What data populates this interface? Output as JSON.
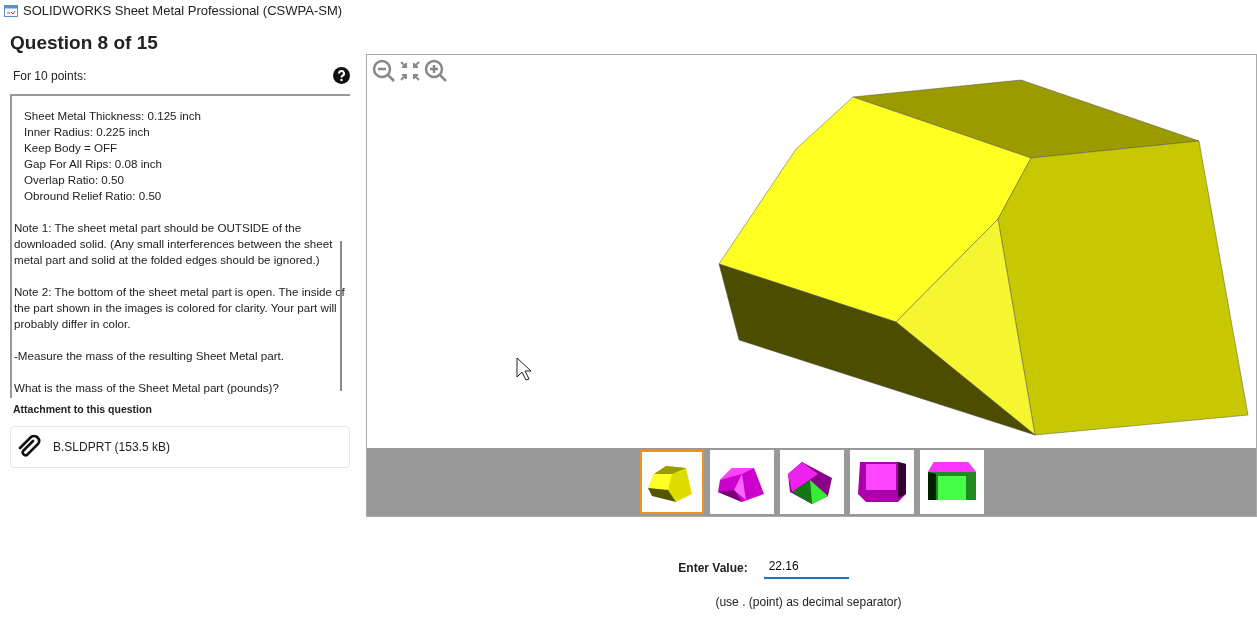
{
  "window": {
    "title": "SOLIDWORKS Sheet Metal Professional (CSWPA-SM)"
  },
  "question": {
    "title": "Question 8 of 15",
    "points": "For 10 points:",
    "parameters": [
      "Sheet Metal Thickness: 0.125 inch",
      "Inner Radius: 0.225 inch",
      "Keep Body = OFF",
      "Gap For All Rips: 0.08 inch",
      "Overlap Ratio: 0.50",
      "Obround Relief Ratio: 0.50"
    ],
    "paragraphs": [
      "Note 1: The sheet metal part should be OUTSIDE of the downloaded solid.  (Any small interferences between the sheet metal part and solid at the folded edges should be ignored.)",
      "Note 2: The bottom of the sheet metal part is open.  The inside of the part shown in the images is colored for clarity.  Your part will probably differ in color.",
      "-Measure the mass of the resulting Sheet Metal part.",
      "What is the mass of the Sheet Metal part (pounds)?"
    ]
  },
  "attachment": {
    "heading": "Attachment to this question",
    "file": "B.SLDPRT (153.5 kB)"
  },
  "viewer": {
    "thumbnails": [
      {
        "selected": true
      },
      {
        "selected": false
      },
      {
        "selected": false
      },
      {
        "selected": false
      },
      {
        "selected": false
      }
    ]
  },
  "answer": {
    "label": "Enter Value:",
    "value": "22.16",
    "hint": "(use . (point) as decimal separator)"
  }
}
